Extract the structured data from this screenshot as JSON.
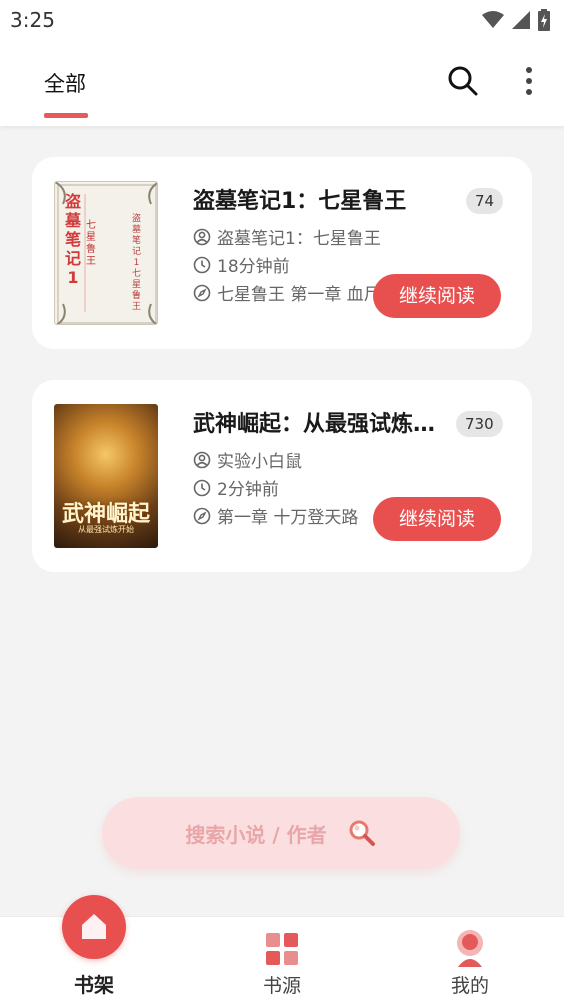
{
  "status_bar": {
    "time": "3:25"
  },
  "header": {
    "tab_all": "全部"
  },
  "books": [
    {
      "title": "盗墓笔记1：七星鲁王",
      "badge": "74",
      "author": "盗墓笔记1：七星鲁王",
      "updated": "18分钟前",
      "latest_chapter": "七星鲁王 第一章 血尸",
      "continue_label": "继续阅读",
      "cover_title": "盗墓笔记1",
      "cover_subtitle": "七星鲁王",
      "cover_side": "盗墓笔记1七星鲁王"
    },
    {
      "title": "武神崛起：从最强试炼开始",
      "badge": "730",
      "author": "实验小白鼠",
      "updated": "2分钟前",
      "latest_chapter": "第一章 十万登天路",
      "continue_label": "继续阅读",
      "cover_title": "武神崛起",
      "cover_subtitle": "从最强试炼开始"
    }
  ],
  "search": {
    "placeholder": "搜索小说 / 作者"
  },
  "bottom_nav": {
    "bookshelf": "书架",
    "sources": "书源",
    "mine": "我的"
  },
  "colors": {
    "accent": "#e84f4f",
    "pill": "#fbdfe0"
  }
}
